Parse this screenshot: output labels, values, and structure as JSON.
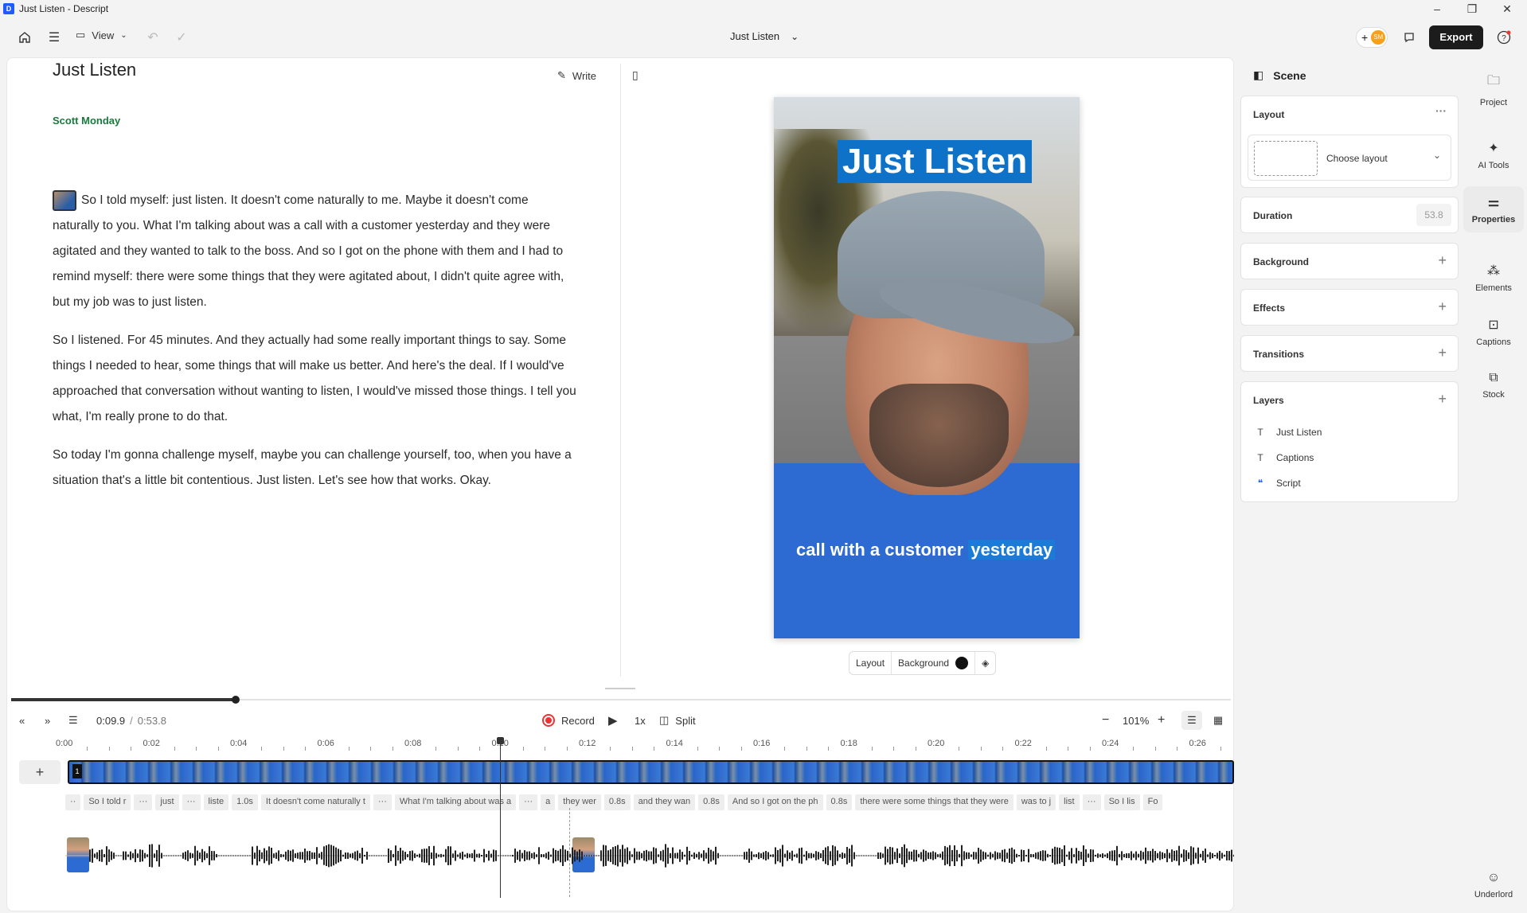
{
  "window": {
    "title": "Just Listen - Descript",
    "minimize": "–",
    "maximize": "❐",
    "close": "✕"
  },
  "toolbar": {
    "view_label": "View",
    "project_title": "Just Listen",
    "avatar_initials": "SM",
    "export_label": "Export"
  },
  "script": {
    "write_label": "Write",
    "doc_title": "Just Listen",
    "speaker": "Scott Monday",
    "paragraphs": [
      "So I told myself: just listen. It doesn't come naturally to me. Maybe it doesn't come naturally to you. What I'm talking about was a call with a customer yesterday and they were agitated and they wanted to talk to the boss. And so I got on the phone with them and I had to remind myself: there were some things that they were agitated about, I didn't quite agree with, but my job was to just listen.",
      "So I listened. For 45 minutes. And they actually had some really important things to say. Some things I needed to hear, some things that will make us better. And here's the deal. If I would've approached that conversation without wanting to listen, I would've missed those things. I tell you what, I'm really prone to do that.",
      "So today I'm gonna challenge myself, maybe you can challenge yourself, too, when you have a situation that's a little bit contentious. Just listen. Let's see how that works. Okay."
    ]
  },
  "preview": {
    "title_overlay": "Just Listen",
    "caption_plain": "call with a customer",
    "caption_highlight": "yesterday",
    "toolbar": {
      "layout": "Layout",
      "background": "Background"
    }
  },
  "playback": {
    "progress": 0.184,
    "current_time": "0:09.9",
    "separator": "/",
    "total_time": "0:53.8",
    "record_label": "Record",
    "speed": "1x",
    "split_label": "Split",
    "zoom": "101%"
  },
  "timeline": {
    "ticks": [
      "0:00",
      "0:02",
      "0:04",
      "0:06",
      "0:08",
      "0:10",
      "0:12",
      "0:14",
      "0:16",
      "0:18",
      "0:20",
      "0:22",
      "0:24",
      "0:26"
    ],
    "add_label": "+",
    "words": [
      "··",
      "So I told r",
      "···",
      "just",
      "···",
      "liste",
      "1.0s",
      "It doesn't come naturally t",
      "···",
      "What I'm talking about was a",
      "···",
      "a",
      "they wer",
      "0.8s",
      "and they wan",
      "0.8s",
      "And so I got on the ph",
      "0.8s",
      "there were some things that they were",
      "was to j",
      "list",
      "···",
      "So I lis",
      "Fo"
    ]
  },
  "sidebar": {
    "title": "Scene",
    "layout_title": "Layout",
    "layout_more": "···",
    "choose_layout": "Choose layout",
    "duration_label": "Duration",
    "duration_value": "53.8",
    "background_label": "Background",
    "effects_label": "Effects",
    "transitions_label": "Transitions",
    "layers_label": "Layers",
    "layers": [
      {
        "icon": "T",
        "name": "Just Listen"
      },
      {
        "icon": "T",
        "name": "Captions"
      },
      {
        "icon": "❝",
        "name": "Script"
      }
    ]
  },
  "nav": {
    "project": "Project",
    "ai_tools": "AI Tools",
    "properties": "Properties",
    "elements": "Elements",
    "captions": "Captions",
    "stock": "Stock",
    "underlord": "Underlord"
  }
}
